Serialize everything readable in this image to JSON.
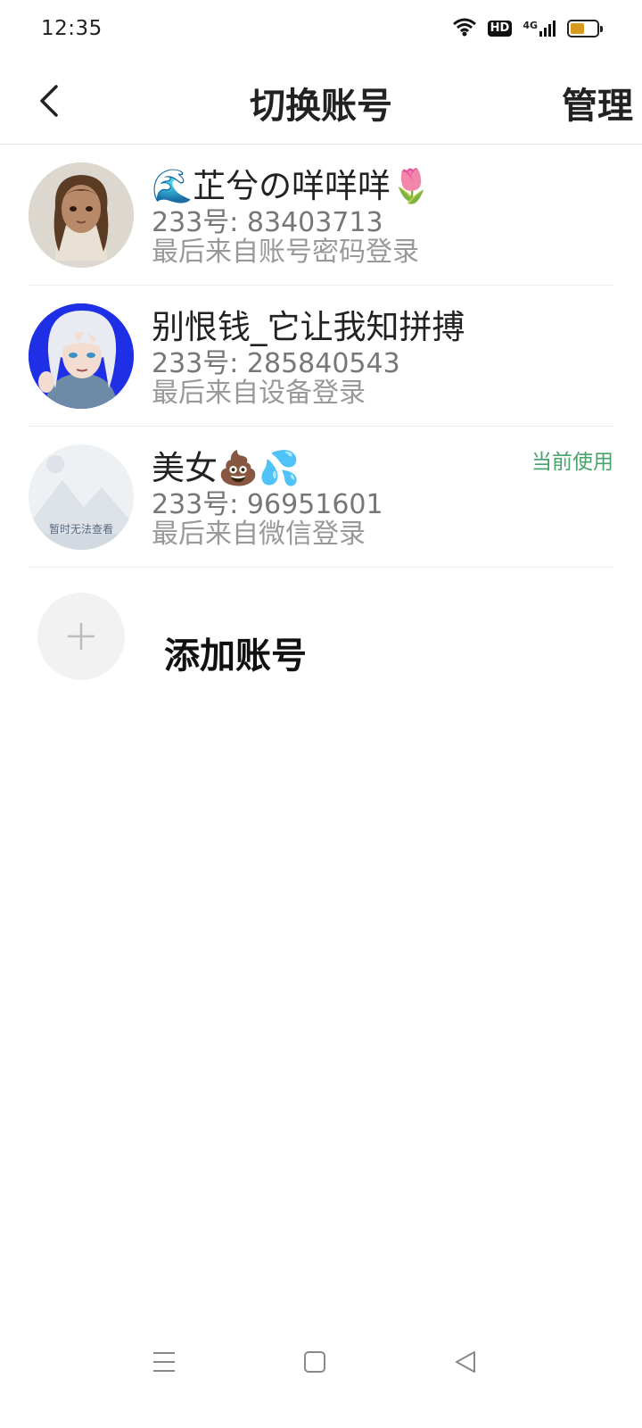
{
  "status_bar": {
    "time": "12:35",
    "hd": "HD",
    "network": "4G",
    "battery_level": 0.55,
    "battery_color": "#d89a1f"
  },
  "nav": {
    "title": "切换账号",
    "manage_label": "管理"
  },
  "accounts": [
    {
      "name": "🌊芷兮の咩咩咩🌷",
      "id_text": "233号: 83403713",
      "last_login": "最后来自账号密码登录",
      "avatar": "anime-girl-brown-hair",
      "current": false
    },
    {
      "name": "别恨钱_它让我知拼搏",
      "id_text": "233号: 285840543",
      "last_login": "最后来自设备登录",
      "avatar": "anime-boy-white-hair",
      "current": false
    },
    {
      "name": "美女💩💦",
      "id_text": "233号: 96951601",
      "last_login": "最后来自微信登录",
      "avatar": "placeholder-image",
      "avatar_caption": "暂时无法查看",
      "current": true,
      "current_label": "当前使用"
    }
  ],
  "add_account": {
    "label": "添加账号"
  },
  "colors": {
    "accent_green": "#4aa36a",
    "divider": "#ececec"
  }
}
